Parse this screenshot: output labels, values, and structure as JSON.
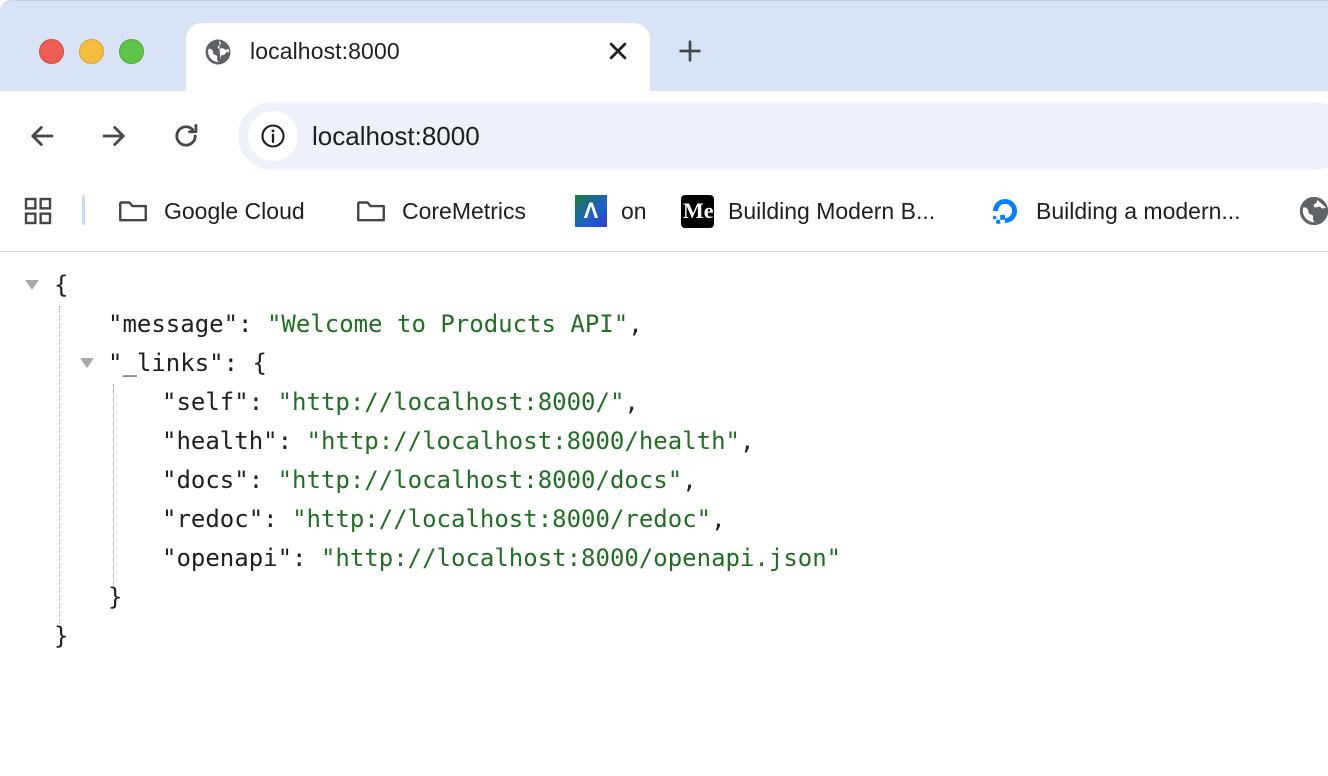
{
  "window": {
    "controls": [
      "close",
      "minimize",
      "zoom"
    ]
  },
  "tab": {
    "title": "localhost:8000",
    "icon": "globe-icon",
    "close_icon": "close-icon",
    "new_tab_icon": "plus-icon"
  },
  "toolbar": {
    "back_icon": "arrow-left-icon",
    "forward_icon": "arrow-right-icon",
    "reload_icon": "reload-icon",
    "site_info_icon": "info-icon",
    "url": "localhost:8000"
  },
  "bookmarks": {
    "apps_icon": "apps-grid-icon",
    "items": [
      {
        "label": "Google Cloud",
        "icon": "folder-icon"
      },
      {
        "label": "CoreMetrics",
        "icon": "folder-icon"
      },
      {
        "label": "on",
        "icon": "avatar-a-icon",
        "icon_text": "Λ"
      },
      {
        "label": "Building Modern B...",
        "icon": "medium-icon",
        "icon_text": "Me"
      },
      {
        "label": "Building a modern...",
        "icon": "digitalocean-icon"
      },
      {
        "label": "",
        "icon": "globe-icon"
      }
    ]
  },
  "json_view": {
    "open_brace": "{",
    "close_brace": "}",
    "message_key": "\"message\"",
    "message_value": "\"Welcome to Products API\"",
    "links_key": "\"_links\"",
    "links": [
      {
        "key": "\"self\"",
        "value": "\"http://localhost:8000/\"",
        "comma": ","
      },
      {
        "key": "\"health\"",
        "value": "\"http://localhost:8000/health\"",
        "comma": ","
      },
      {
        "key": "\"docs\"",
        "value": "\"http://localhost:8000/docs\"",
        "comma": ","
      },
      {
        "key": "\"redoc\"",
        "value": "\"http://localhost:8000/redoc\"",
        "comma": ","
      },
      {
        "key": "\"openapi\"",
        "value": "\"http://localhost:8000/openapi.json\"",
        "comma": ""
      }
    ]
  },
  "colors": {
    "tabstrip_bg": "#d8e4f6",
    "omnibox_bg": "#edf2fa",
    "json_string": "#236e25"
  }
}
